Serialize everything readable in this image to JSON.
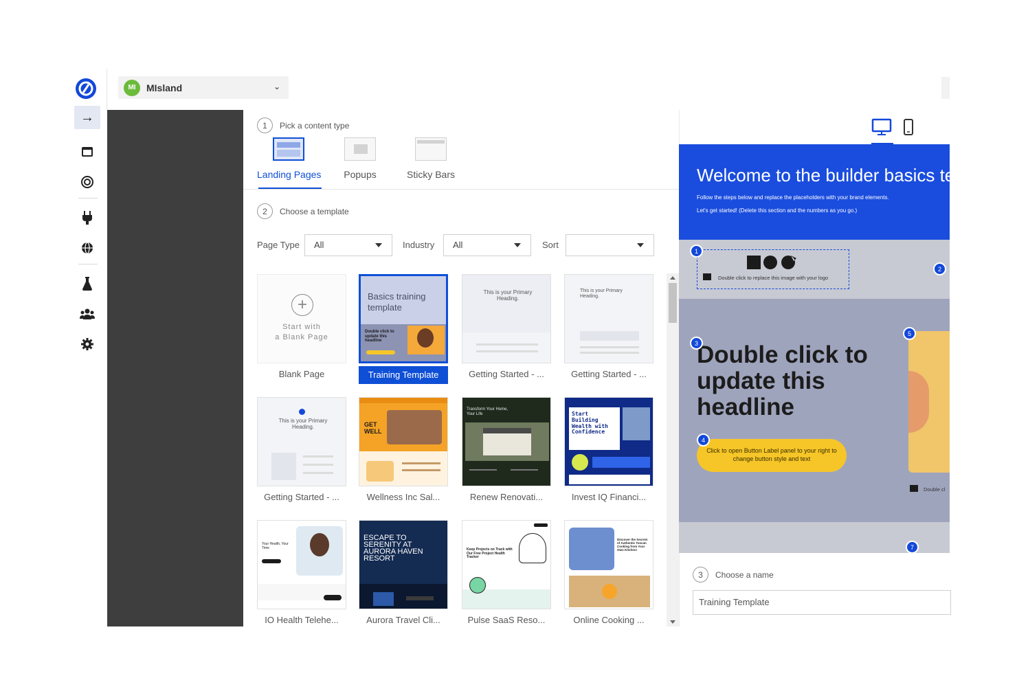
{
  "workspace": {
    "initials": "MI",
    "name": "MIsland"
  },
  "steps": {
    "step1": {
      "num": "1",
      "label": "Pick a content type"
    },
    "step2": {
      "num": "2",
      "label": "Choose a template"
    },
    "step3": {
      "num": "3",
      "label": "Choose a name"
    }
  },
  "content_types": [
    {
      "label": "Landing Pages",
      "active": true
    },
    {
      "label": "Popups"
    },
    {
      "label": "Sticky Bars"
    }
  ],
  "filters": {
    "page_type": {
      "label": "Page Type",
      "value": "All"
    },
    "industry": {
      "label": "Industry",
      "value": "All"
    },
    "sort": {
      "label": "Sort",
      "value": ""
    }
  },
  "templates": [
    {
      "name": "Blank Page",
      "blank_line1": "Start with",
      "blank_line2": "a Blank Page"
    },
    {
      "name": "Training Template",
      "thumb_title": "Basics training template",
      "thumb_sub": "Double click to update this headline",
      "selected": true
    },
    {
      "name": "Getting Started - ...",
      "thumb_title": "This is your Primary Heading."
    },
    {
      "name": "Getting Started - ...",
      "thumb_title": "This is your Primary Heading."
    },
    {
      "name": "Getting Started - ...",
      "thumb_title": "This is your Primary Heading."
    },
    {
      "name": "Wellness Inc Sal...",
      "thumb_title": "GET WELL"
    },
    {
      "name": "Renew Renovati...",
      "thumb_title": "Transform Your Home, Your Life"
    },
    {
      "name": "Invest IQ Financi...",
      "thumb_title": "Start Building Wealth with Confidence"
    },
    {
      "name": "IO Health Telehe...",
      "thumb_title": "Your Health, Your Time"
    },
    {
      "name": "Aurora Travel Cli...",
      "thumb_title": "ESCAPE TO SERENITY AT AURORA HAVEN RESORT"
    },
    {
      "name": "Pulse SaaS Reso...",
      "thumb_title": "Keep Projects on Track with Our Free Project Health Tracker"
    },
    {
      "name": "Online Cooking ...",
      "thumb_title": "Discover the Secrets of Authentic Tuscan Cooking from Your Own Kitchen!"
    }
  ],
  "preview": {
    "title": "Welcome to the builder basics tem",
    "line1": "Follow the steps below and replace the placeholders with your brand elements.",
    "line2": "Let's get started! (Delete this section and the numbers as you go.)",
    "logo_hint": "Double click to replace this image with your logo",
    "headline": "Double click to update this headline",
    "button_text": "Click to open Button Label panel to your right to change button style and text",
    "image_hint": "Double cl",
    "badges": [
      "1",
      "2",
      "3",
      "4",
      "5",
      "7"
    ]
  },
  "name_field": {
    "value": "Training Template"
  },
  "colors": {
    "accent": "#0f4fd6",
    "brand_blue": "#1a4dde",
    "dark_panel": "#3e3e3e",
    "button_yellow": "#f6c628"
  }
}
